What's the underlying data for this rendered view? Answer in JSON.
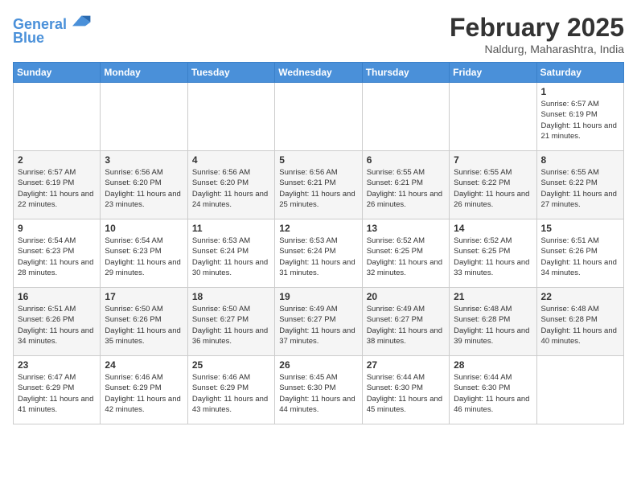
{
  "header": {
    "logo": {
      "line1": "General",
      "line2": "Blue"
    },
    "title": "February 2025",
    "location": "Naldurg, Maharashtra, India"
  },
  "weekdays": [
    "Sunday",
    "Monday",
    "Tuesday",
    "Wednesday",
    "Thursday",
    "Friday",
    "Saturday"
  ],
  "weeks": [
    [
      {
        "day": "",
        "sunrise": "",
        "sunset": "",
        "daylight": ""
      },
      {
        "day": "",
        "sunrise": "",
        "sunset": "",
        "daylight": ""
      },
      {
        "day": "",
        "sunrise": "",
        "sunset": "",
        "daylight": ""
      },
      {
        "day": "",
        "sunrise": "",
        "sunset": "",
        "daylight": ""
      },
      {
        "day": "",
        "sunrise": "",
        "sunset": "",
        "daylight": ""
      },
      {
        "day": "",
        "sunrise": "",
        "sunset": "",
        "daylight": ""
      },
      {
        "day": "1",
        "sunrise": "Sunrise: 6:57 AM",
        "sunset": "Sunset: 6:19 PM",
        "daylight": "Daylight: 11 hours and 21 minutes."
      }
    ],
    [
      {
        "day": "2",
        "sunrise": "Sunrise: 6:57 AM",
        "sunset": "Sunset: 6:19 PM",
        "daylight": "Daylight: 11 hours and 22 minutes."
      },
      {
        "day": "3",
        "sunrise": "Sunrise: 6:56 AM",
        "sunset": "Sunset: 6:20 PM",
        "daylight": "Daylight: 11 hours and 23 minutes."
      },
      {
        "day": "4",
        "sunrise": "Sunrise: 6:56 AM",
        "sunset": "Sunset: 6:20 PM",
        "daylight": "Daylight: 11 hours and 24 minutes."
      },
      {
        "day": "5",
        "sunrise": "Sunrise: 6:56 AM",
        "sunset": "Sunset: 6:21 PM",
        "daylight": "Daylight: 11 hours and 25 minutes."
      },
      {
        "day": "6",
        "sunrise": "Sunrise: 6:55 AM",
        "sunset": "Sunset: 6:21 PM",
        "daylight": "Daylight: 11 hours and 26 minutes."
      },
      {
        "day": "7",
        "sunrise": "Sunrise: 6:55 AM",
        "sunset": "Sunset: 6:22 PM",
        "daylight": "Daylight: 11 hours and 26 minutes."
      },
      {
        "day": "8",
        "sunrise": "Sunrise: 6:55 AM",
        "sunset": "Sunset: 6:22 PM",
        "daylight": "Daylight: 11 hours and 27 minutes."
      }
    ],
    [
      {
        "day": "9",
        "sunrise": "Sunrise: 6:54 AM",
        "sunset": "Sunset: 6:23 PM",
        "daylight": "Daylight: 11 hours and 28 minutes."
      },
      {
        "day": "10",
        "sunrise": "Sunrise: 6:54 AM",
        "sunset": "Sunset: 6:23 PM",
        "daylight": "Daylight: 11 hours and 29 minutes."
      },
      {
        "day": "11",
        "sunrise": "Sunrise: 6:53 AM",
        "sunset": "Sunset: 6:24 PM",
        "daylight": "Daylight: 11 hours and 30 minutes."
      },
      {
        "day": "12",
        "sunrise": "Sunrise: 6:53 AM",
        "sunset": "Sunset: 6:24 PM",
        "daylight": "Daylight: 11 hours and 31 minutes."
      },
      {
        "day": "13",
        "sunrise": "Sunrise: 6:52 AM",
        "sunset": "Sunset: 6:25 PM",
        "daylight": "Daylight: 11 hours and 32 minutes."
      },
      {
        "day": "14",
        "sunrise": "Sunrise: 6:52 AM",
        "sunset": "Sunset: 6:25 PM",
        "daylight": "Daylight: 11 hours and 33 minutes."
      },
      {
        "day": "15",
        "sunrise": "Sunrise: 6:51 AM",
        "sunset": "Sunset: 6:26 PM",
        "daylight": "Daylight: 11 hours and 34 minutes."
      }
    ],
    [
      {
        "day": "16",
        "sunrise": "Sunrise: 6:51 AM",
        "sunset": "Sunset: 6:26 PM",
        "daylight": "Daylight: 11 hours and 34 minutes."
      },
      {
        "day": "17",
        "sunrise": "Sunrise: 6:50 AM",
        "sunset": "Sunset: 6:26 PM",
        "daylight": "Daylight: 11 hours and 35 minutes."
      },
      {
        "day": "18",
        "sunrise": "Sunrise: 6:50 AM",
        "sunset": "Sunset: 6:27 PM",
        "daylight": "Daylight: 11 hours and 36 minutes."
      },
      {
        "day": "19",
        "sunrise": "Sunrise: 6:49 AM",
        "sunset": "Sunset: 6:27 PM",
        "daylight": "Daylight: 11 hours and 37 minutes."
      },
      {
        "day": "20",
        "sunrise": "Sunrise: 6:49 AM",
        "sunset": "Sunset: 6:27 PM",
        "daylight": "Daylight: 11 hours and 38 minutes."
      },
      {
        "day": "21",
        "sunrise": "Sunrise: 6:48 AM",
        "sunset": "Sunset: 6:28 PM",
        "daylight": "Daylight: 11 hours and 39 minutes."
      },
      {
        "day": "22",
        "sunrise": "Sunrise: 6:48 AM",
        "sunset": "Sunset: 6:28 PM",
        "daylight": "Daylight: 11 hours and 40 minutes."
      }
    ],
    [
      {
        "day": "23",
        "sunrise": "Sunrise: 6:47 AM",
        "sunset": "Sunset: 6:29 PM",
        "daylight": "Daylight: 11 hours and 41 minutes."
      },
      {
        "day": "24",
        "sunrise": "Sunrise: 6:46 AM",
        "sunset": "Sunset: 6:29 PM",
        "daylight": "Daylight: 11 hours and 42 minutes."
      },
      {
        "day": "25",
        "sunrise": "Sunrise: 6:46 AM",
        "sunset": "Sunset: 6:29 PM",
        "daylight": "Daylight: 11 hours and 43 minutes."
      },
      {
        "day": "26",
        "sunrise": "Sunrise: 6:45 AM",
        "sunset": "Sunset: 6:30 PM",
        "daylight": "Daylight: 11 hours and 44 minutes."
      },
      {
        "day": "27",
        "sunrise": "Sunrise: 6:44 AM",
        "sunset": "Sunset: 6:30 PM",
        "daylight": "Daylight: 11 hours and 45 minutes."
      },
      {
        "day": "28",
        "sunrise": "Sunrise: 6:44 AM",
        "sunset": "Sunset: 6:30 PM",
        "daylight": "Daylight: 11 hours and 46 minutes."
      },
      {
        "day": "",
        "sunrise": "",
        "sunset": "",
        "daylight": ""
      }
    ]
  ]
}
